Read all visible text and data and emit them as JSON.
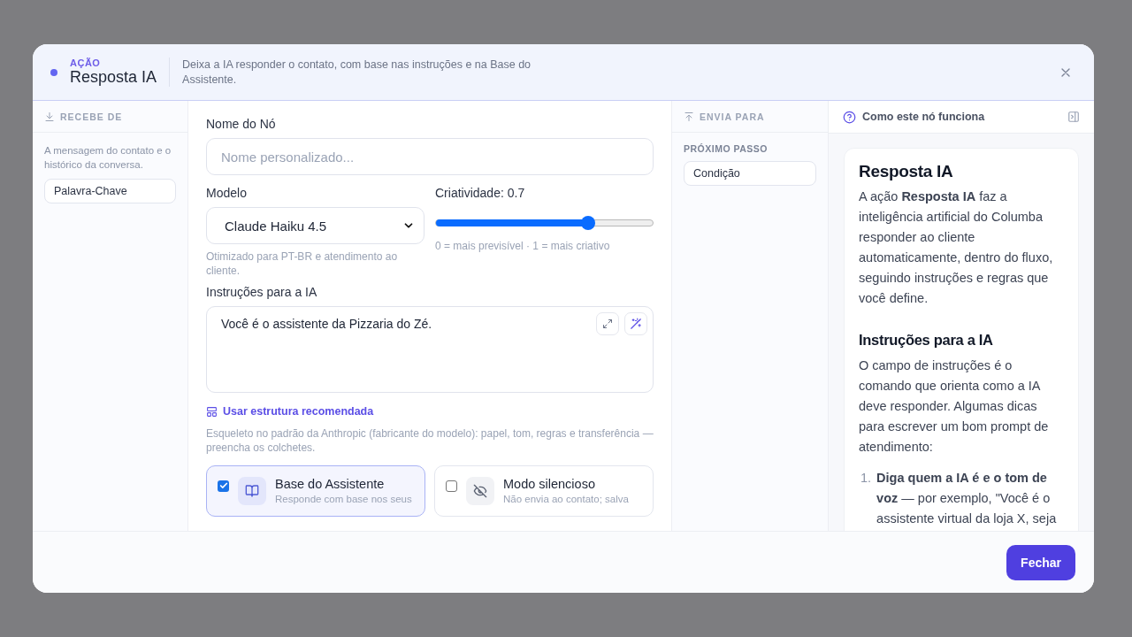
{
  "header": {
    "kicker": "AÇÃO",
    "title": "Resposta IA",
    "description": "Deixa a IA responder o contato, com base nas instruções e na Base do Assistente."
  },
  "receives": {
    "heading": "RECEBE DE",
    "text": "A mensagem do contato e o histórico da conversa.",
    "source": "Palavra-Chave"
  },
  "form": {
    "name": {
      "label": "Nome do Nó",
      "placeholder": "Nome personalizado..."
    },
    "model": {
      "label": "Modelo",
      "value": "Claude Haiku 4.5",
      "hint": "Otimizado para PT-BR e atendimento ao cliente."
    },
    "creativity": {
      "label": "Criatividade: 0.7",
      "level": 0.7,
      "hint": "0 = mais previsível · 1 = mais criativo"
    },
    "instructions": {
      "label": "Instruções para a IA",
      "value": "Você é o assistente da Pizzaria do Zé."
    },
    "template_link": "Usar estrutura recomendada",
    "template_hint": "Esqueleto no padrão da Anthropic (fabricante do modelo): papel, tom, regras e transferência — preencha os colchetes.",
    "options": [
      {
        "kind": "book",
        "title": "Base do Assistente",
        "subtitle": "Responde com base nos seus",
        "checked": true
      },
      {
        "kind": "eye-off",
        "title": "Modo silencioso",
        "subtitle": "Não envia ao contato; salva",
        "checked": false
      }
    ]
  },
  "sends": {
    "heading": "ENVIA PARA",
    "label": "PRÓXIMO PASSO",
    "target": "Condição"
  },
  "help": {
    "heading": "Como este nó funciona",
    "title": "Resposta IA",
    "intro": "A ação **Resposta IA** faz a inteligência artificial do Columba responder ao cliente automaticamente, dentro do fluxo, seguindo instruções e regras que você define.",
    "section": "Instruções para a IA",
    "section_text": "O campo de instruções é o comando que orienta como a IA deve responder. Algumas dicas para escrever um bom prompt de atendimento:",
    "tips": [
      {
        "number": "1.",
        "text": "**Diga quem a IA é e o tom de voz** — por exemplo, \"Você é o assistente virtual da loja X, seja"
      }
    ]
  },
  "footer": {
    "button": "Fechar"
  }
}
